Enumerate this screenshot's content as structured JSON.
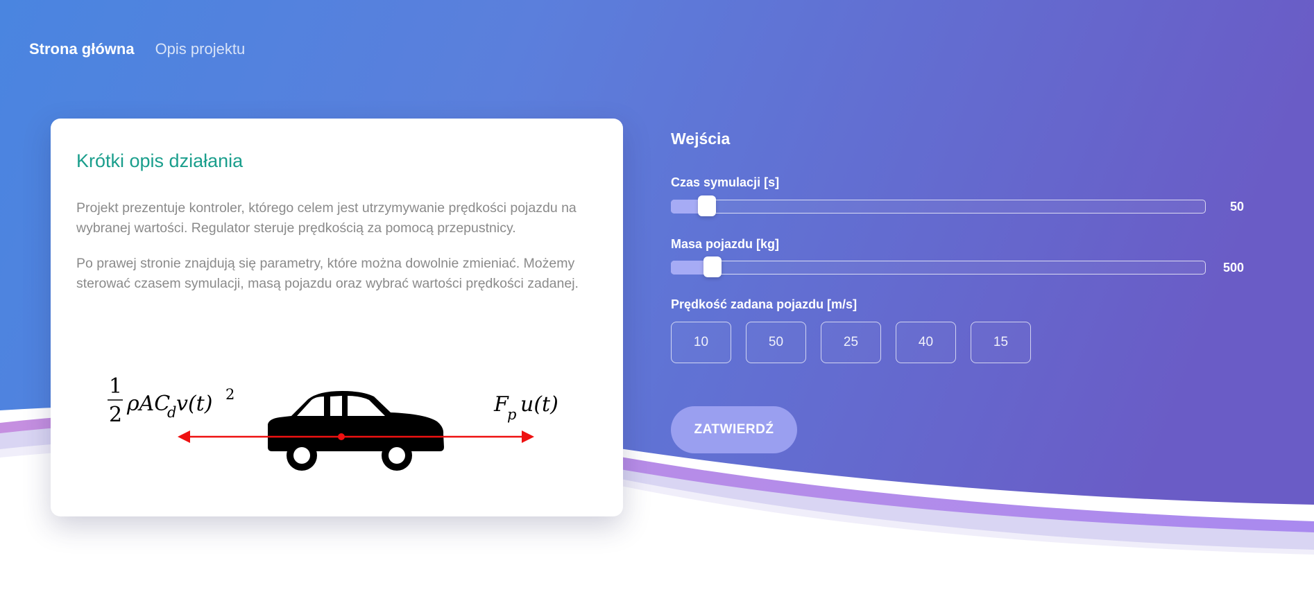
{
  "nav": {
    "home": "Strona główna",
    "project": "Opis projektu"
  },
  "card": {
    "title": "Krótki opis działania",
    "paragraph1": "Projekt prezentuje kontroler, którego celem jest utrzymywanie prędkości pojazdu na wybranej wartości. Regulator steruje prędkością za pomocą przepustnicy.",
    "paragraph2": "Po prawej stronie znajdują się parametry, które można dowolnie zmieniać. Możemy sterować czasem symulacji, masą pojazdu oraz wybrać wartości prędkości zadanej.",
    "formula_left_num": "1",
    "formula_left_den": "2",
    "formula_left_expr": "ρAC",
    "formula_left_sub": "d",
    "formula_left_tail": "v(t)",
    "formula_left_sup": "2",
    "formula_right_main": "F",
    "formula_right_sub": "p",
    "formula_right_tail": "u(t)"
  },
  "inputs": {
    "title": "Wejścia",
    "sim_time": {
      "label": "Czas symulacji [s]",
      "value": "50",
      "fraction": 0.065
    },
    "mass": {
      "label": "Masa pojazdu [kg]",
      "value": "500",
      "fraction": 0.076
    },
    "speed_label": "Prędkość zadana pojazdu [m/s]",
    "speeds": [
      "10",
      "50",
      "25",
      "40",
      "15"
    ],
    "submit": "ZATWIERDŹ"
  },
  "colors": {
    "gradient_start": "#4a85e0",
    "gradient_end": "#6a5cc6",
    "card_title": "#1a9e8c",
    "slider_fill": "#a6abf5",
    "button": "#9a9ff0",
    "arrow": "#ee1111"
  }
}
